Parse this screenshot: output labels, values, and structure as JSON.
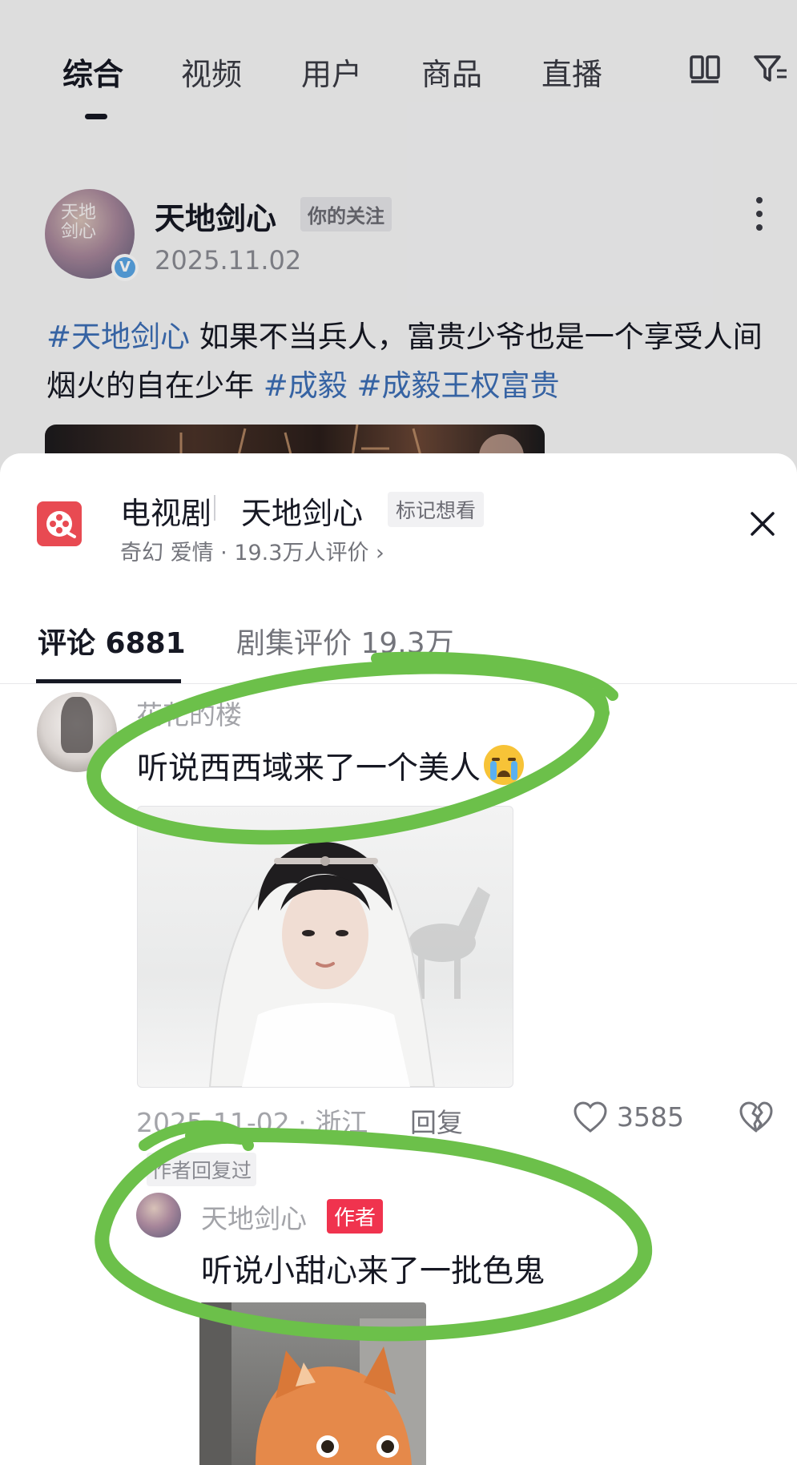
{
  "search_tabs": {
    "items": [
      "综合",
      "视频",
      "用户",
      "商品",
      "直播"
    ],
    "active": "综合"
  },
  "post": {
    "author": "天地剑心",
    "avatar_text": "天地剑心",
    "follow_badge": "你的关注",
    "date": "2025.11.02",
    "hashtag_main": "#天地剑心",
    "text": " 如果不当兵人，富贵少爷也是一个享受人间烟火的自在少年 ",
    "hashtag_2": "#成毅",
    "hashtag_3": "#成毅王权富贵"
  },
  "sheet": {
    "type": "电视剧",
    "title": "天地剑心",
    "want_badge": "标记想看",
    "meta": "奇幻 爱情 · 19.3万人评价 ›",
    "tabs": {
      "comments": "评论 6881",
      "reviews": "剧集评价 19.3万"
    }
  },
  "comment": {
    "user": "花花的楼",
    "text": "听说西西域来了一个美人",
    "meta": "2025-11-02 · 浙江",
    "reply": "回复",
    "likes": "3585"
  },
  "reply": {
    "badge": "作者回复过",
    "user": "天地剑心",
    "author_tag": "作者",
    "text": "听说小甜心来了一批色鬼"
  },
  "colors": {
    "hashtag": "#3d6fb6",
    "author_tag": "#f0334e",
    "drama_icon": "#e84a52",
    "annotation": "#6cc04a"
  }
}
